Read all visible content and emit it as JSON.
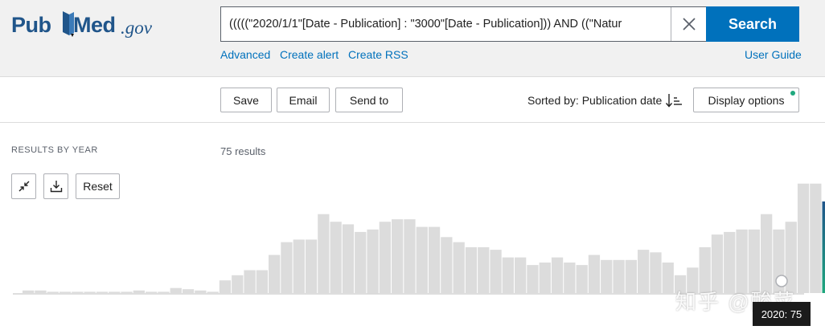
{
  "header": {
    "logo_pub": "Pub",
    "logo_med": "Med",
    "logo_gov": ".gov",
    "search_query": "(((((\"2020/1/1\"[Date - Publication] : \"3000\"[Date - Publication])) AND ((\"Natur",
    "search_label": "Search",
    "links": {
      "advanced": "Advanced",
      "create_alert": "Create alert",
      "create_rss": "Create RSS",
      "user_guide": "User Guide"
    }
  },
  "toolbar": {
    "save": "Save",
    "email": "Email",
    "send_to": "Send to",
    "sorted_by": "Sorted by: Publication date",
    "display_options": "Display options"
  },
  "timeline": {
    "section_label": "RESULTS BY YEAR",
    "results_count": "75 results",
    "reset": "Reset",
    "tooltip": "2020: 75"
  },
  "watermark": "知乎 @酸菜",
  "colors": {
    "brand": "#20558a",
    "primary": "#0071bc",
    "bar": "#dcdcdc",
    "bar_active_top": "#20558a",
    "bar_active_bottom": "#20a87e"
  },
  "chart_data": {
    "type": "bar",
    "values": [
      1,
      1,
      0.5,
      0.5,
      0.5,
      0.5,
      0.5,
      0.5,
      0.5,
      1,
      0.5,
      0.5,
      2,
      1.5,
      1,
      0.5,
      5,
      7,
      9,
      9,
      15,
      20,
      21,
      21,
      31,
      28,
      27,
      24,
      25,
      28,
      29,
      29,
      26,
      26,
      22,
      20,
      18,
      18,
      17,
      14,
      14,
      11,
      12,
      14,
      12,
      11,
      15,
      13,
      13,
      13,
      17,
      16,
      12,
      7,
      10,
      18,
      23,
      24,
      25,
      25,
      31,
      25,
      28,
      43,
      43,
      36
    ],
    "active_index": 65
  }
}
